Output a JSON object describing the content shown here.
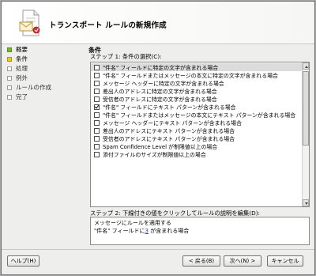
{
  "window": {
    "title": "トランスポート ルールの新規作成"
  },
  "wizard_steps": [
    {
      "label": "概要",
      "state": "done"
    },
    {
      "label": "条件",
      "state": "current"
    },
    {
      "label": "処理",
      "state": "pending"
    },
    {
      "label": "例外",
      "state": "pending"
    },
    {
      "label": "ルールの作成",
      "state": "pending"
    },
    {
      "label": "完了",
      "state": "pending"
    }
  ],
  "main": {
    "heading": "条件",
    "step1_label": "ステップ 1: 条件の選択(C):",
    "conditions": [
      {
        "label": "\"件名\" フィールドに特定の文字が含まれる場合",
        "checked": false,
        "selected": true
      },
      {
        "label": "\"件名\" フィールドまたはメッセージの本文に特定の文字が含まれる場合",
        "checked": false,
        "selected": false
      },
      {
        "label": "メッセージ ヘッダーに特定の文字が含まれる場合",
        "checked": false,
        "selected": false
      },
      {
        "label": "差出人のアドレスに特定の文字が含まれる場合",
        "checked": false,
        "selected": false
      },
      {
        "label": "受信者のアドレスに特定の文字が含まれる場合",
        "checked": false,
        "selected": false
      },
      {
        "label": "\"件名\" フィールドにテキスト パターンが含まれる場合",
        "checked": true,
        "selected": false
      },
      {
        "label": "\"件名\" フィールドまたはメッセージの本文にテキスト パターンが含まれる場合",
        "checked": false,
        "selected": false
      },
      {
        "label": "メッセージ ヘッダーにテキスト パターンが含まれる場合",
        "checked": false,
        "selected": false
      },
      {
        "label": "差出人のアドレスにテキスト パターンが含まれる場合",
        "checked": false,
        "selected": false
      },
      {
        "label": "受信者のアドレスにテキスト パターンが含まれる場合",
        "checked": false,
        "selected": false
      },
      {
        "label": "Spam Confidence Level が制限値以上の場合",
        "checked": false,
        "selected": false
      },
      {
        "label": "添付ファイルのサイズが制限値以上の場合",
        "checked": false,
        "selected": false
      }
    ],
    "step2_label": "ステップ 2: 下線付きの値をクリックしてルールの説明を編集(D):",
    "description": {
      "line1": "メッセージにルールを適用する",
      "line2_prefix": "\"件名\" フィールドに",
      "line2_link": "3",
      "line2_suffix": " が含まれる場合"
    }
  },
  "footer": {
    "help_label": "ヘルプ(H)",
    "back_label": "< 戻る(B)",
    "next_label": "次へ(N) >",
    "cancel_label": "キャンセル"
  },
  "colors": {
    "done": "#76b52c",
    "current": "#f1c232",
    "link": "#1f3ccf",
    "selected_row": "#dcdcdc"
  },
  "icons": {
    "wizard": "document-wizard-icon",
    "scroll_up": "scroll-up-arrow-icon",
    "scroll_down": "scroll-down-arrow-icon"
  }
}
